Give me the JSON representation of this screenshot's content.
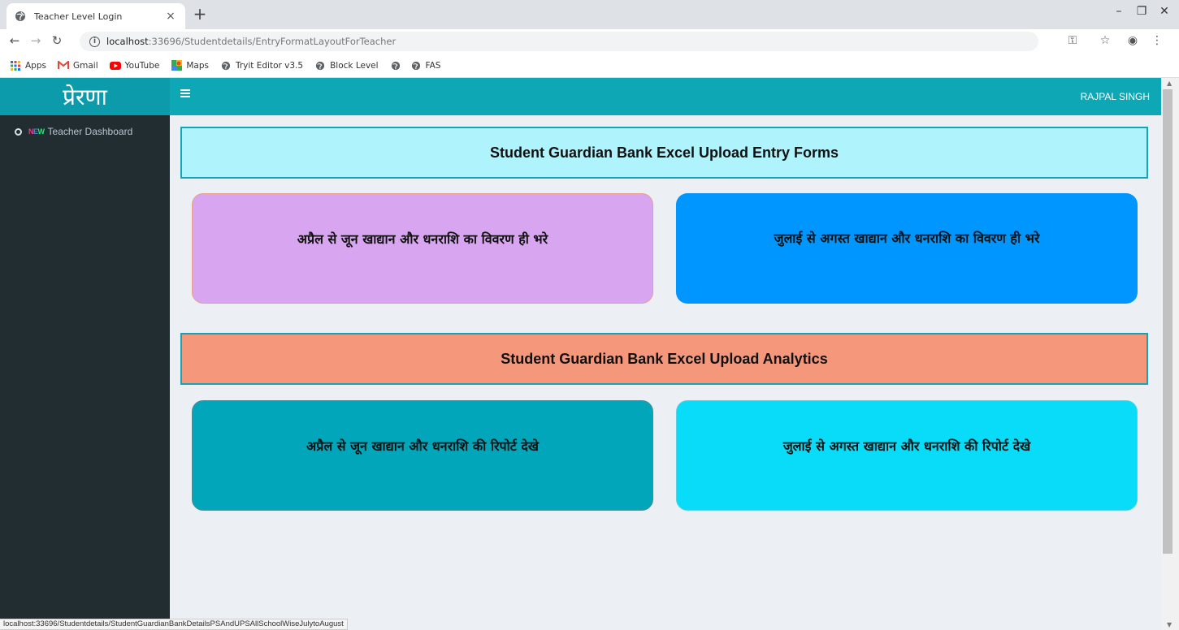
{
  "browser": {
    "tab_title": "Teacher Level Login",
    "tab_close": "×",
    "new_tab": "+",
    "url_host": "localhost",
    "url_rest": ":33696/Studentdetails/EntryFormatLayoutForTeacher",
    "bookmarks": [
      {
        "label": "Apps",
        "icon": "apps-grid-icon"
      },
      {
        "label": "Gmail",
        "icon": "gmail-icon"
      },
      {
        "label": "YouTube",
        "icon": "youtube-icon"
      },
      {
        "label": "Maps",
        "icon": "maps-icon"
      },
      {
        "label": "Tryit Editor v3.5",
        "icon": "globe-icon"
      },
      {
        "label": "Block Level",
        "icon": "globe-icon"
      },
      {
        "label": "",
        "icon": "globe-icon"
      },
      {
        "label": "FAS",
        "icon": "globe-icon"
      }
    ],
    "status_url": "localhost:33696/Studentdetails/StudentGuardianBankDetailsPSAndUPSAllSchoolWiseJulytoAugust"
  },
  "app": {
    "logo": "प्रेरणा",
    "user_name": "RAJPAL SINGH",
    "sidebar": {
      "items": [
        {
          "badge": "NEW",
          "label": "Teacher Dashboard"
        }
      ]
    },
    "sections": [
      {
        "title": "Student Guardian Bank Excel Upload Entry Forms",
        "cards": [
          "अप्रैल से जून खाद्यान और धनराशि का विवरण ही भरे",
          "जुलाई से अगस्त खाद्यान और धनराशि का विवरण ही भरे"
        ]
      },
      {
        "title": "Student Guardian Bank Excel Upload Analytics",
        "cards": [
          "अप्रैल से जून खाद्यान और धनराशि की रिपोर्ट देखे",
          "जुलाई से अगस्त खाद्यान और धनराशि की रिपोर्ट देखे"
        ]
      }
    ]
  },
  "colors": {
    "header": "#0ea7b5",
    "sidebar": "#222d32",
    "entry_header": "#aff4fc",
    "analytics_header": "#f5977b",
    "card_april_entry": "#d8a6f0",
    "card_july_entry": "#0096ff",
    "card_april_report": "#02a6bb",
    "card_july_report": "#08dcf8"
  }
}
